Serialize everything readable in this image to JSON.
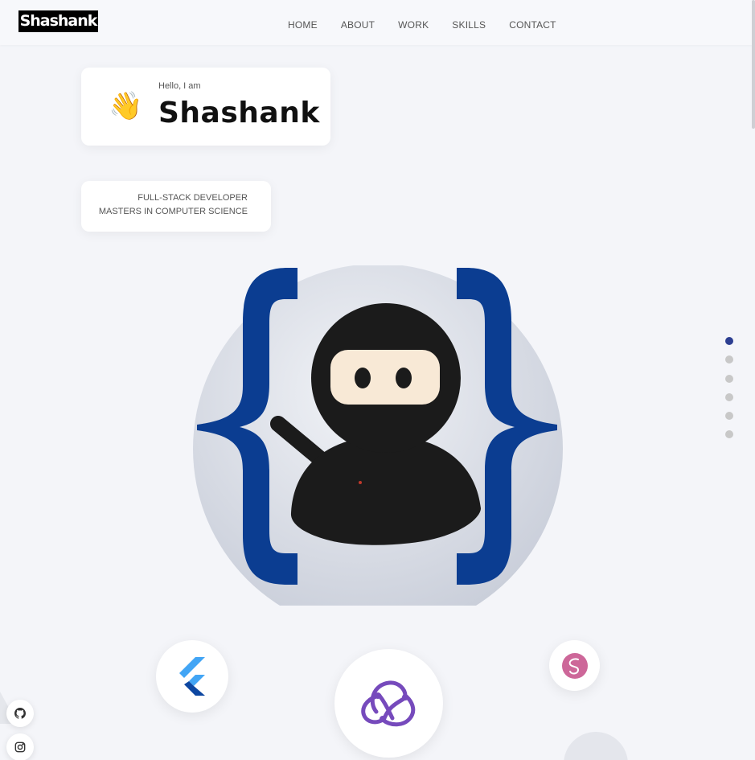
{
  "header": {
    "logo": "Shashank",
    "nav": [
      "HOME",
      "ABOUT",
      "WORK",
      "SKILLS",
      "CONTACT"
    ]
  },
  "intro": {
    "greeting": "Hello, I am",
    "name": "Shashank",
    "wave_icon": "waving-hand-icon",
    "role_line_1": "FULL-STACK DEVELOPER",
    "role_line_2": "MASTERS IN COMPUTER SCIENCE"
  },
  "hero": {
    "image": "ninja-with-curly-braces-illustration"
  },
  "section_dots": {
    "count": 6,
    "active_index": 0
  },
  "skills": [
    "flutter-icon",
    "redux-icon",
    "sass-icon"
  ],
  "social": [
    "github-icon",
    "instagram-icon"
  ],
  "colors": {
    "background": "#f4f5f9",
    "accent_dot": "#2c3e91",
    "brace_blue": "#0b3d91",
    "ninja": "#1b1b1b",
    "mask": "#f8e9d6",
    "redux": "#764abc",
    "sass": "#cd6799",
    "flutter_light": "#42a5f5",
    "flutter_dark": "#0d47a1"
  }
}
